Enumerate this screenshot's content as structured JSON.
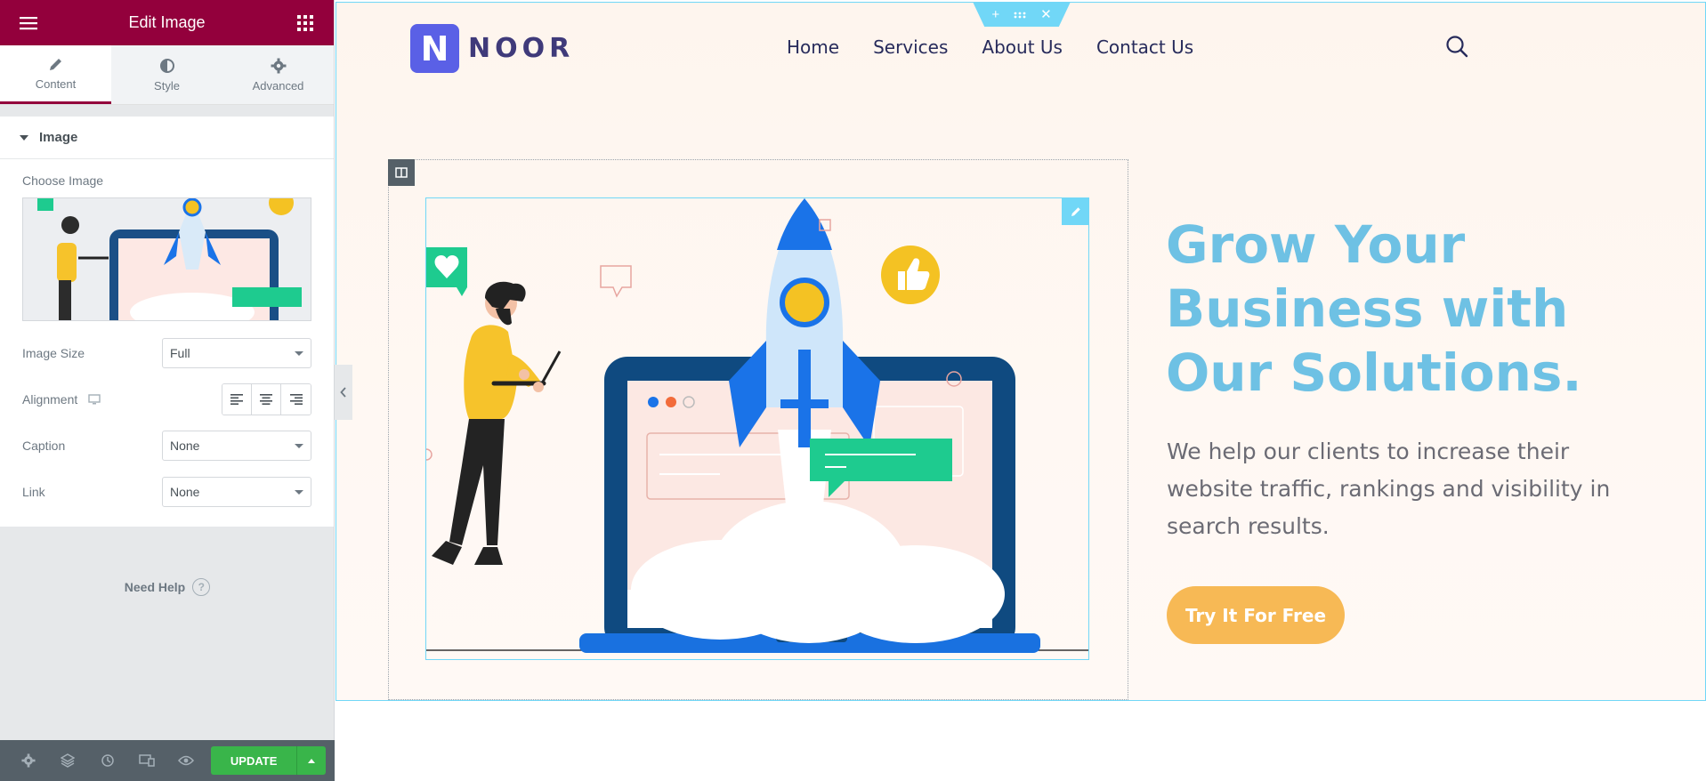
{
  "panel": {
    "title": "Edit Image",
    "tabs": [
      {
        "label": "Content",
        "icon": "pencil-icon"
      },
      {
        "label": "Style",
        "icon": "contrast-icon"
      },
      {
        "label": "Advanced",
        "icon": "gear-icon"
      }
    ],
    "section_title": "Image",
    "choose_image_label": "Choose Image",
    "controls": {
      "image_size": {
        "label": "Image Size",
        "value": "Full"
      },
      "alignment": {
        "label": "Alignment",
        "selected": "left"
      },
      "caption": {
        "label": "Caption",
        "value": "None"
      },
      "link": {
        "label": "Link",
        "value": "None"
      }
    },
    "help_label": "Need Help",
    "help_glyph": "?",
    "update_label": "UPDATE",
    "colors": {
      "header": "#93003c",
      "update": "#39b54a",
      "footer": "#556068"
    }
  },
  "site": {
    "logo_letter": "N",
    "logo_text": "NOOR",
    "nav": [
      "Home",
      "Services",
      "About Us",
      "Contact Us"
    ],
    "heading_lines": [
      "Grow Your",
      "Business with",
      "Our Solutions."
    ],
    "subtext": "We help our clients to increase their website traffic, rankings and visibility in search results.",
    "cta_label": "Try It For Free",
    "colors": {
      "heading": "#6ec1e4",
      "cta": "#f7b955",
      "logo": "#5a60e6",
      "selection": "#71d7f7"
    }
  }
}
